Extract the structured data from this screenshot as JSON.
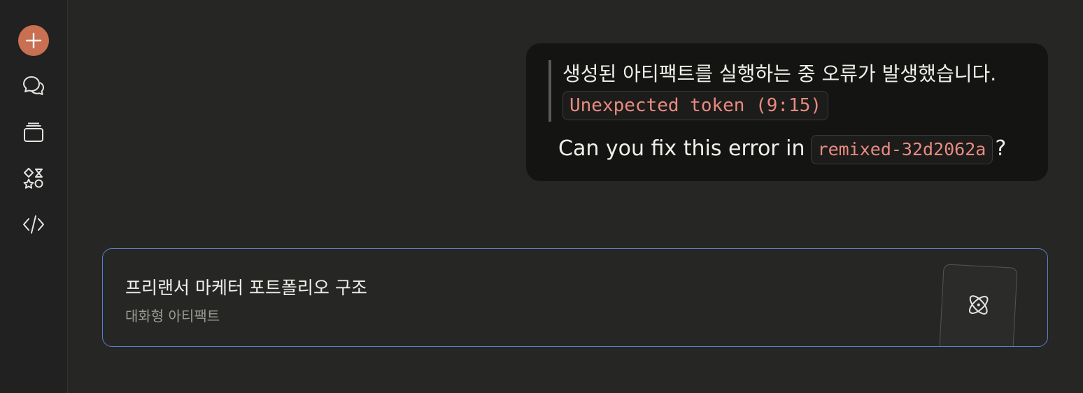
{
  "sidebar": {
    "new_chat_icon": "plus-icon",
    "items": [
      {
        "icon": "chats-icon"
      },
      {
        "icon": "projects-icon"
      },
      {
        "icon": "artifacts-icon"
      },
      {
        "icon": "code-icon"
      }
    ],
    "accent": "#c96f52"
  },
  "message": {
    "quote_text": "생성된 아티팩트를 실행하는 중 오류가 발생했습니다.",
    "quote_code": "Unexpected token (9:15)",
    "ask_prefix": "Can you fix this error in",
    "ask_code": "remixed-32d2062a",
    "ask_suffix": "?"
  },
  "artifact_card": {
    "title": "프리랜서 마케터 포트폴리오 구조",
    "subtitle": "대화형 아티팩트",
    "icon": "atom-icon",
    "border_color": "#5b82c9"
  }
}
